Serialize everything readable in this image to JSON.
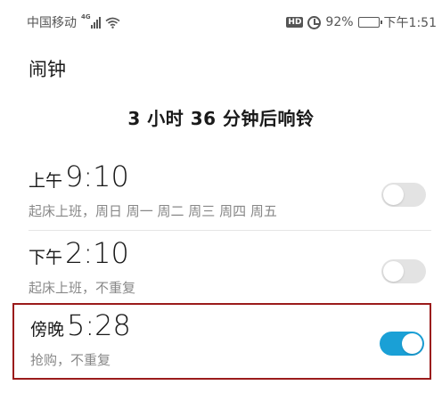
{
  "status_bar": {
    "carrier": "中国移动",
    "network": "4G",
    "battery": "92%",
    "battery_level": 0.92,
    "time": "下午1:51",
    "hd_label": "HD",
    "icons": [
      "signal-icon",
      "wifi-icon",
      "hd-icon",
      "alarm-clock-icon",
      "battery-icon"
    ]
  },
  "page": {
    "title": "闹钟",
    "countdown": "3 小时 36 分钟后响铃"
  },
  "alarms": [
    {
      "period": "上午",
      "time": "9:10",
      "description": "起床上班，周日 周一 周二 周三 周四 周五",
      "enabled": false
    },
    {
      "period": "下午",
      "time": "2:10",
      "description": "起床上班，不重复",
      "enabled": false
    },
    {
      "period": "傍晚",
      "time": "5:28",
      "description": "抢购，不重复",
      "enabled": true
    }
  ],
  "colors": {
    "toggle_on": "#1aa0d6",
    "toggle_off": "#e3e3e3",
    "highlight_border": "#9b1b1b"
  }
}
